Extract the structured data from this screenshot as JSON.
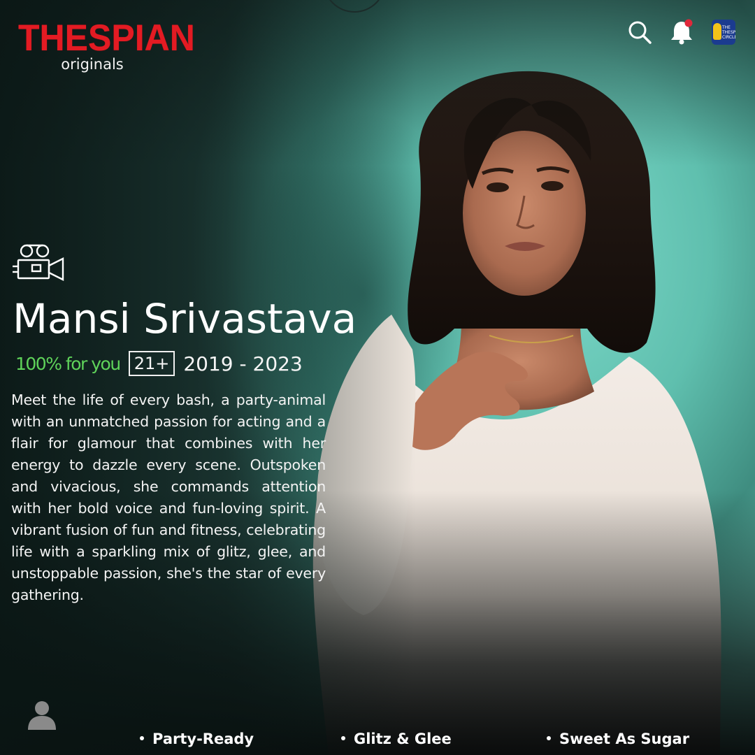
{
  "brand": {
    "logo": "THESPIAN",
    "subtitle": "originals",
    "logo_color": "#e31b23"
  },
  "header": {
    "icons": [
      "search-icon",
      "bell-icon",
      "profile-badge"
    ],
    "notification_dot_color": "#e0283a",
    "badge_text": "THE THESPIAN CIRCLE"
  },
  "profile": {
    "icon": "movie-camera-icon",
    "name": "Mansi Srivastava",
    "match": "100% for you",
    "match_color": "#5fd35a",
    "age_rating": "21+",
    "years": "2019 - 2023",
    "description": "Meet the life of every bash, a party-animal with an unmatched passion for acting and a flair for glamour that combines with her energy to dazzle every scene. Outspoken and vivacious, she commands attention with her bold voice and fun-loving spirit. A vibrant fusion of fun and fitness, celebrating life with a sparkling mix of glitz, glee, and unstoppable passion, she's the star of every gathering."
  },
  "footer": {
    "user_icon": "user-icon",
    "tags": [
      "Party-Ready",
      "Glitz & Glee",
      "Sweet As Sugar"
    ]
  }
}
